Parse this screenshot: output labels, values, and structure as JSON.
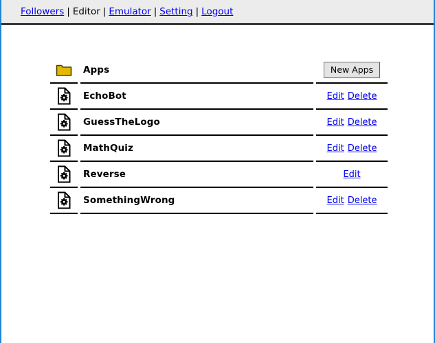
{
  "nav": {
    "items": [
      {
        "label": "Followers",
        "type": "link",
        "name": "nav-followers"
      },
      {
        "label": "Editor",
        "type": "current",
        "name": "nav-editor"
      },
      {
        "label": "Emulator",
        "type": "link",
        "name": "nav-emulator"
      },
      {
        "label": "Setting",
        "type": "link",
        "name": "nav-setting"
      },
      {
        "label": "Logout",
        "type": "link",
        "name": "nav-logout"
      }
    ],
    "separator": "|"
  },
  "colors": {
    "header_background": "#ececec",
    "page_border": "#1f85d6",
    "link": "#0000ee",
    "folder_icon": "#e2b900",
    "rule": "#000000",
    "button_face": "#e4e4e4"
  },
  "table": {
    "rows": [
      {
        "icon": "folder-icon",
        "name": "Apps",
        "actions": [],
        "button": "New Apps"
      },
      {
        "icon": "app-file-icon",
        "name": "EchoBot",
        "actions": [
          "Edit",
          "Delete"
        ]
      },
      {
        "icon": "app-file-icon",
        "name": "GuessTheLogo",
        "actions": [
          "Edit",
          "Delete"
        ]
      },
      {
        "icon": "app-file-icon",
        "name": "MathQuiz",
        "actions": [
          "Edit",
          "Delete"
        ]
      },
      {
        "icon": "app-file-icon",
        "name": "Reverse",
        "actions": [
          "Edit"
        ]
      },
      {
        "icon": "app-file-icon",
        "name": "SomethingWrong",
        "actions": [
          "Edit",
          "Delete"
        ]
      }
    ]
  }
}
